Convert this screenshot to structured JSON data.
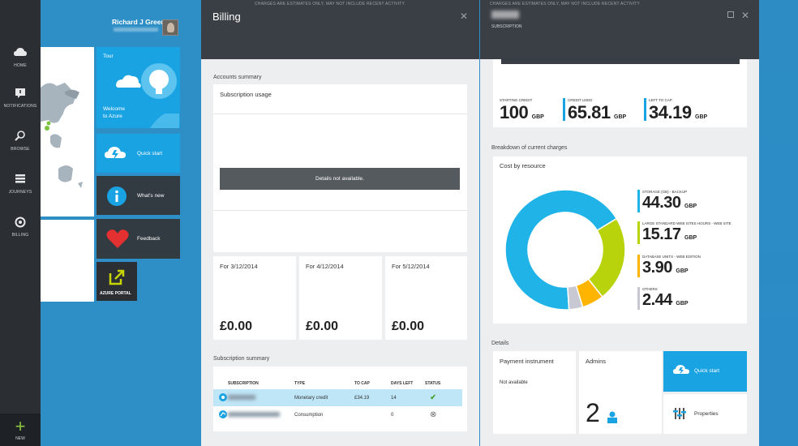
{
  "nav": {
    "items": [
      {
        "label": "HOME",
        "icon": "cloud-icon"
      },
      {
        "label": "NOTIFICATIONS",
        "icon": "notifications-icon"
      },
      {
        "label": "BROWSE",
        "icon": "browse-icon"
      },
      {
        "label": "JOURNEYS",
        "icon": "journeys-icon"
      },
      {
        "label": "BILLING",
        "icon": "billing-icon"
      }
    ],
    "new_label": "NEW"
  },
  "user": {
    "name": "Richard J Green"
  },
  "tiles": {
    "tour_title": "Tour",
    "tour_caption_1": "Welcome",
    "tour_caption_2": "to Azure",
    "quick_start": "Quick start",
    "whats_new": "What's new",
    "feedback": "Feedback",
    "azure_portal": "AZURE PORTAL"
  },
  "billing": {
    "notice": "CHARGES ARE ESTIMATES ONLY, MAY NOT INCLUDE RECENT ACTIVITY",
    "title": "Billing",
    "accounts_summary": "Accounts summary",
    "subscription_usage": "Subscription usage",
    "details_not_available": "Details not available.",
    "periods": [
      {
        "label": "For 3/12/2014",
        "value": "£0.00"
      },
      {
        "label": "For 4/12/2014",
        "value": "£0.00"
      },
      {
        "label": "For 5/12/2014",
        "value": "£0.00"
      }
    ],
    "subscription_summary": "Subscription summary",
    "table": {
      "headers": [
        "SUBSCRIPTION",
        "TYPE",
        "TO CAP",
        "DAYS LEFT",
        "STATUS"
      ],
      "rows": [
        {
          "type": "Monetary credit",
          "to_cap": "£34.19",
          "days_left": "14",
          "status": "✔"
        },
        {
          "type": "Consumption",
          "to_cap": "",
          "days_left": "0",
          "status": "⊗"
        }
      ]
    }
  },
  "subscription": {
    "notice": "CHARGES ARE ESTIMATES ONLY, MAY NOT INCLUDE RECENT ACTIVITY",
    "subtitle": "SUBSCRIPTION",
    "credits": [
      {
        "label": "STARTING CREDIT",
        "value": "100",
        "unit": "GBP"
      },
      {
        "label": "CREDIT USED",
        "value": "65.81",
        "unit": "GBP"
      },
      {
        "label": "LEFT TO CAP",
        "value": "34.19",
        "unit": "GBP"
      }
    ],
    "breakdown_label": "Breakdown of current charges",
    "cost_by_resource": "Cost by resource",
    "resources": [
      {
        "name": "STORAGE (GB) - BACKUP",
        "value": "44.30",
        "unit": "GBP",
        "color": "#1fb3e8",
        "share": 0.6555
      },
      {
        "name": "LARGE STANDARD WEB SITES HOURS - WEB SITE",
        "value": "15.17",
        "unit": "GBP",
        "color": "#b8d30b",
        "share": 0.2245
      },
      {
        "name": "DATABASE UNITS - WEB EDITION",
        "value": "3.90",
        "unit": "GBP",
        "color": "#ffb400",
        "share": 0.0577
      },
      {
        "name": "OTHERS",
        "value": "2.44",
        "unit": "GBP",
        "color": "#c8c8d2",
        "share": 0.0361
      }
    ],
    "details_label": "Details",
    "payment_instrument": "Payment instrument",
    "payment_value": "Not available",
    "admins_label": "Admins",
    "admins_count": "2",
    "quick_start": "Quick start",
    "properties": "Properties"
  }
}
